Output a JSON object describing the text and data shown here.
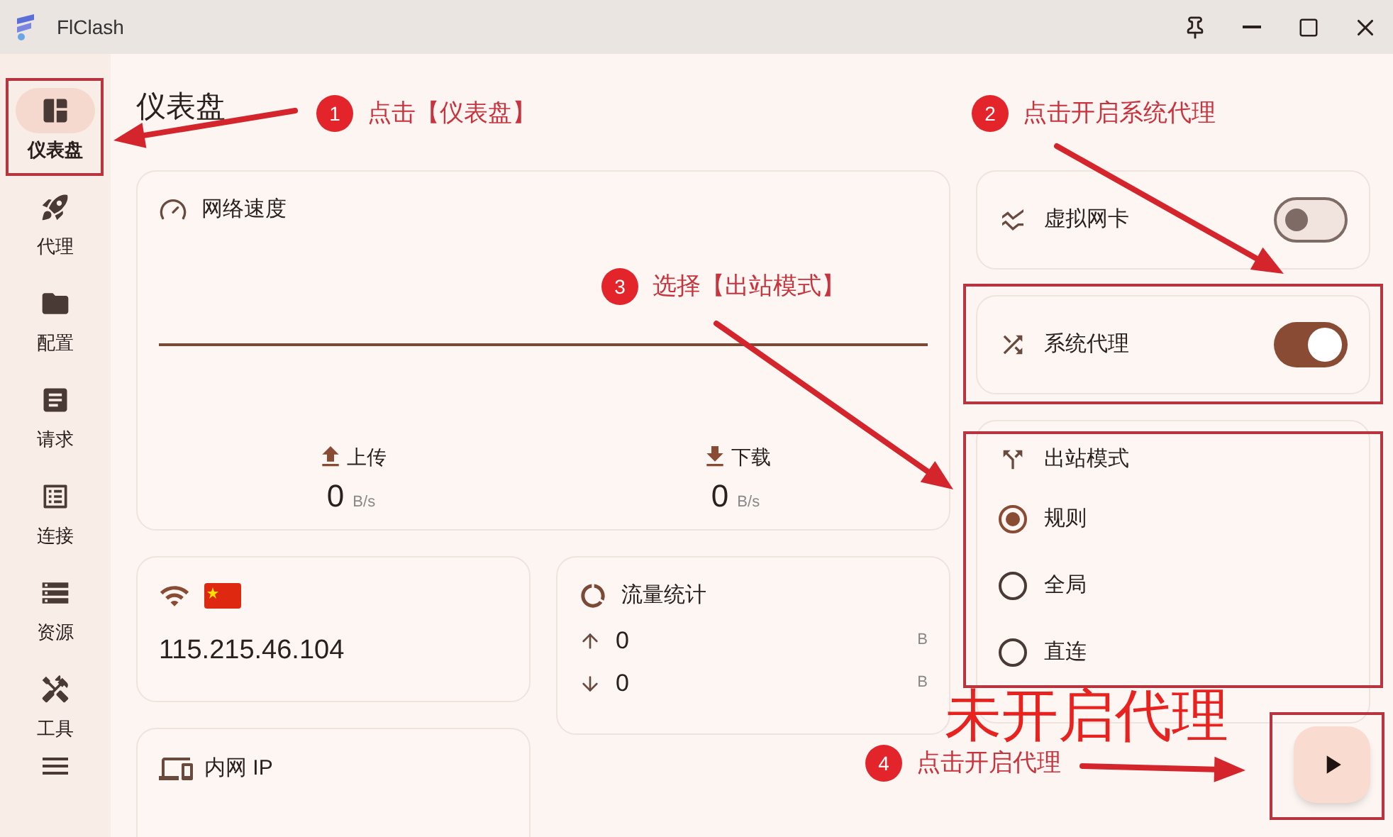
{
  "window": {
    "title": "FlClash"
  },
  "sidebar": {
    "items": [
      {
        "label": "仪表盘",
        "selected": true
      },
      {
        "label": "代理",
        "selected": false
      },
      {
        "label": "配置",
        "selected": false
      },
      {
        "label": "请求",
        "selected": false
      },
      {
        "label": "连接",
        "selected": false
      },
      {
        "label": "资源",
        "selected": false
      },
      {
        "label": "工具",
        "selected": false
      }
    ]
  },
  "page_title": "仪表盘",
  "network_speed": {
    "title": "网络速度",
    "rates": [
      {
        "kind": "up",
        "label": "上传",
        "value": "0",
        "unit": "B/s"
      },
      {
        "kind": "down",
        "label": "下载",
        "value": "0",
        "unit": "B/s"
      }
    ]
  },
  "ip_card": {
    "ip": "115.215.46.104"
  },
  "intranet_card": {
    "title": "内网 IP"
  },
  "traffic": {
    "title": "流量统计",
    "rows": [
      {
        "kind": "up",
        "value": "0",
        "unit": "B"
      },
      {
        "kind": "down",
        "value": "0",
        "unit": "B"
      }
    ]
  },
  "virtual_nic": {
    "label": "虚拟网卡",
    "on": false
  },
  "system_proxy": {
    "label": "系统代理",
    "on": true
  },
  "outbound_mode": {
    "title": "出站模式",
    "options": [
      {
        "label": "规则",
        "selected": true
      },
      {
        "label": "全局",
        "selected": false
      },
      {
        "label": "直连",
        "selected": false
      }
    ]
  },
  "annotations": [
    {
      "number": "1",
      "text": "点击【仪表盘】"
    },
    {
      "number": "2",
      "text": "点击开启系统代理"
    },
    {
      "number": "3",
      "text": "选择【出站模式】"
    },
    {
      "number": "4",
      "text": "点击开启代理"
    }
  ],
  "banner": "未开启代理"
}
